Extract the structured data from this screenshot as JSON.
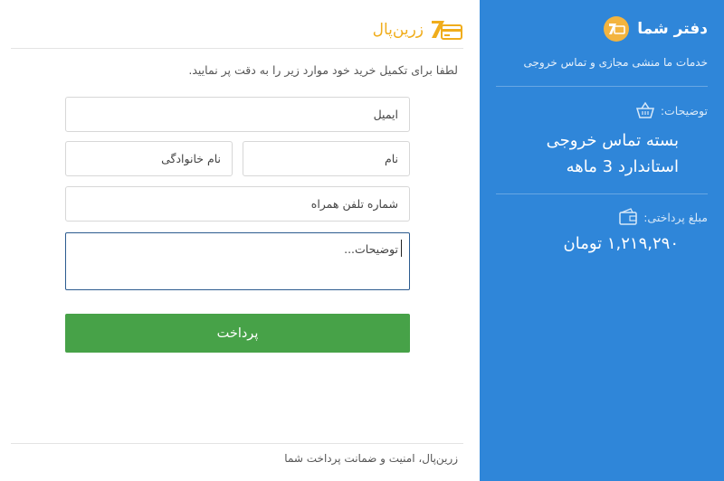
{
  "brand": {
    "name": "زرین‌پال",
    "color": "#f0ad1c"
  },
  "form": {
    "intro": "لطفا برای تکمیل خرید خود موارد زیر را به دقت پر نمایید.",
    "email_placeholder": "ایمیل",
    "first_name_placeholder": "نام",
    "last_name_placeholder": "نام خانوادگی",
    "phone_placeholder": "شماره تلفن همراه",
    "description_placeholder": "توضیحات...",
    "pay_label": "پرداخت",
    "pay_color": "#47a248"
  },
  "footer": {
    "text": "زرین‌پال، امنیت و ضمانت پرداخت شما"
  },
  "sidebar": {
    "title": "دفتر شما",
    "subtitle": "خدمات ما منشی مجازی و تماس خروجی",
    "description_label": "توضیحات:",
    "description_icon": "basket-icon",
    "product_line1": "بسته تماس خروجی",
    "product_line2": "استاندارد 3 ماهه",
    "amount_label": "مبلغ پرداختی:",
    "amount_icon": "wallet-icon",
    "amount": "۱,۲۱۹,۲۹۰ تومان",
    "background": "#2f86d9"
  }
}
